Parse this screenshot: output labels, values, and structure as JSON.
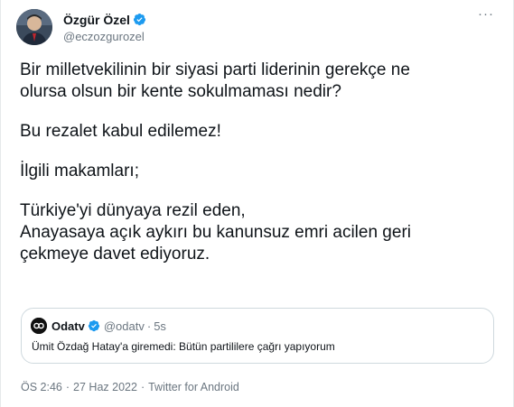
{
  "author": {
    "display_name": "Özgür Özel",
    "handle": "@eczozgurozel",
    "verified": true,
    "verified_color": "#1d9bf0"
  },
  "menu": {
    "more_icon": "more-horizontal-icon",
    "more_glyph": "···"
  },
  "tweet": {
    "paragraphs": [
      "Bir milletvekilinin bir siyasi parti liderinin gerekçe ne\nolursa olsun bir kente sokulmaması nedir?",
      "Bu rezalet kabul edilemez!",
      "İlgili makamları;",
      "Türkiye'yi dünyaya rezil eden,\nAnayasaya açık aykırı bu kanunsuz emri acilen geri\nçekmeye davet ediyoruz."
    ]
  },
  "quoted": {
    "name": "Odatv",
    "handle": "@odatv",
    "dot": "·",
    "time": "5s",
    "text": "Ümit Özdağ Hatay'a giremedi: Bütün partililere çağrı yapıyorum",
    "verified": true
  },
  "meta": {
    "time": "ÖS 2:46",
    "date": "27 Haz 2022",
    "separator": "·",
    "source": "Twitter for Android"
  },
  "colors": {
    "text": "#0f1419",
    "secondary": "#6b7680",
    "border": "#cfd9de",
    "verified": "#1d9bf0"
  }
}
